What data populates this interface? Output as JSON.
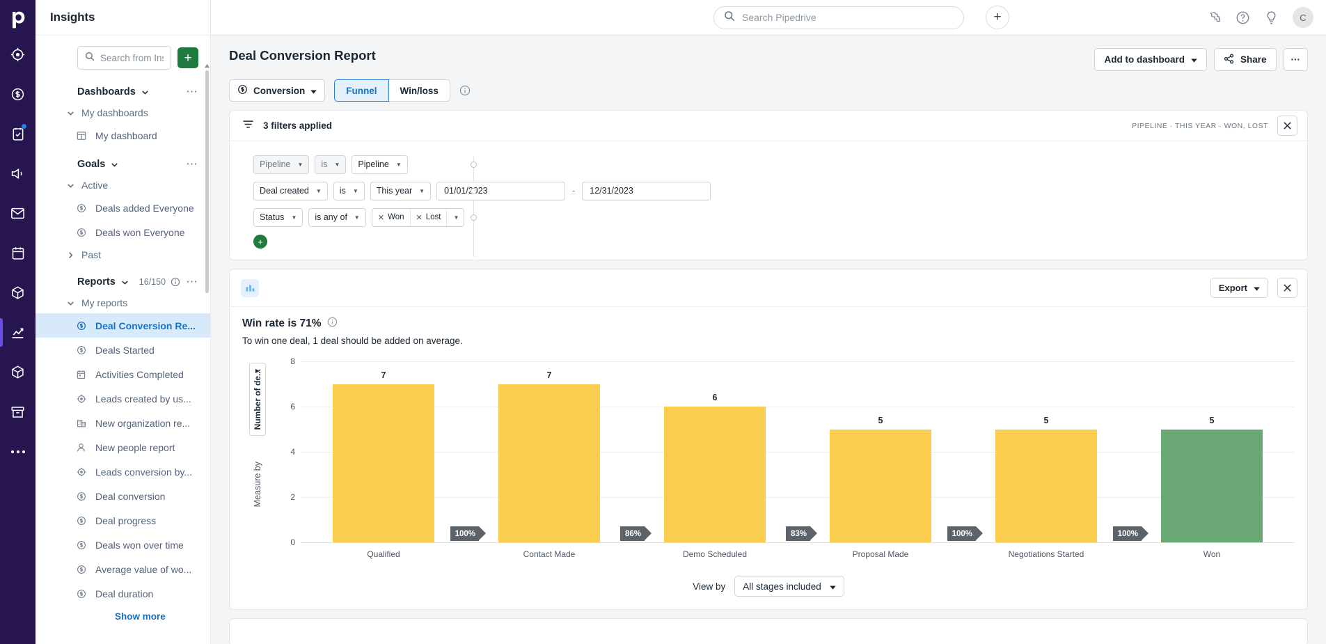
{
  "rail": {
    "logo": "pipedrive-logo",
    "items": [
      {
        "name": "leads-icon",
        "label": "Leads"
      },
      {
        "name": "deals-icon",
        "label": "Deals"
      },
      {
        "name": "activities-icon",
        "label": "Activities",
        "badge": true
      },
      {
        "name": "campaigns-icon",
        "label": "Campaigns"
      },
      {
        "name": "mail-icon",
        "label": "Mail"
      },
      {
        "name": "calendar-icon",
        "label": "Calendar"
      },
      {
        "name": "products-icon",
        "label": "Products"
      },
      {
        "name": "insights-icon",
        "label": "Insights",
        "active": true
      },
      {
        "name": "marketplace-icon",
        "label": "Marketplace"
      },
      {
        "name": "archive-icon",
        "label": "Archive"
      },
      {
        "name": "more-icon",
        "label": "..."
      }
    ]
  },
  "sidebar": {
    "title": "Insights",
    "search": {
      "value": "",
      "placeholder": "Search from Insi..."
    },
    "add_label": "+",
    "sections": [
      {
        "title": "Dashboards",
        "groups": [
          {
            "label": "My dashboards",
            "expanded": true,
            "items": [
              {
                "label": "My dashboard",
                "icon": "dashboard-icon"
              }
            ]
          }
        ]
      },
      {
        "title": "Goals",
        "groups": [
          {
            "label": "Active",
            "expanded": true,
            "items": [
              {
                "label": "Deals added Everyone",
                "icon": "deal-icon"
              },
              {
                "label": "Deals won Everyone",
                "icon": "deal-icon"
              }
            ]
          },
          {
            "label": "Past",
            "expanded": false,
            "items": []
          }
        ]
      },
      {
        "title": "Reports",
        "count": "16/150",
        "groups": [
          {
            "label": "My reports",
            "expanded": true,
            "items": [
              {
                "label": "Deal Conversion Re...",
                "icon": "deal-icon",
                "selected": true
              },
              {
                "label": "Deals Started",
                "icon": "deal-icon"
              },
              {
                "label": "Activities Completed",
                "icon": "calendar-icon"
              },
              {
                "label": "Leads created by us...",
                "icon": "leads-icon"
              },
              {
                "label": "New organization re...",
                "icon": "organization-icon"
              },
              {
                "label": "New people report",
                "icon": "person-icon"
              },
              {
                "label": "Leads conversion by...",
                "icon": "leads-icon"
              },
              {
                "label": "Deal conversion",
                "icon": "deal-icon"
              },
              {
                "label": "Deal progress",
                "icon": "deal-icon"
              },
              {
                "label": "Deals won over time",
                "icon": "deal-icon"
              },
              {
                "label": "Average value of wo...",
                "icon": "deal-icon"
              },
              {
                "label": "Deal duration",
                "icon": "deal-icon"
              }
            ]
          }
        ],
        "show_more": "Show more"
      }
    ]
  },
  "topbar": {
    "search": {
      "value": "",
      "placeholder": "Search Pipedrive"
    },
    "plus_label": "+",
    "icons": [
      "puzzle-icon",
      "help-icon",
      "lightbulb-icon"
    ],
    "avatar_initial": "C"
  },
  "report": {
    "title": "Deal Conversion Report",
    "type_selector": "Conversion",
    "tabs": [
      {
        "label": "Funnel",
        "active": true
      },
      {
        "label": "Win/loss",
        "active": false
      }
    ],
    "add_to_dashboard": "Add to dashboard",
    "share": "Share",
    "more": "···"
  },
  "filters": {
    "header": "3 filters applied",
    "meta": "PIPELINE · THIS YEAR · WON, LOST",
    "rows": [
      {
        "field": "Pipeline",
        "operator": "is",
        "value": "Pipeline",
        "dim": true
      },
      {
        "field": "Deal created",
        "operator": "is",
        "value": "This year",
        "date_from": "01/01/2023",
        "date_to": "12/31/2023",
        "dash": "-"
      },
      {
        "field": "Status",
        "operator": "is any of",
        "chips": [
          "Won",
          "Lost"
        ]
      }
    ],
    "add_label": "+"
  },
  "chart_panel": {
    "export": "Export",
    "win_rate_title": "Win rate is 71%",
    "win_rate_sub": "To win one deal, 1 deal should be added on average.",
    "measure_selector": "Number of de...",
    "measure_label": "Measure by",
    "view_by_label": "View by",
    "view_by_value": "All stages included"
  },
  "chart_data": {
    "type": "bar",
    "title": "Win rate is 71%",
    "xlabel": "",
    "ylabel": "Number of deals",
    "ylim": [
      0,
      8
    ],
    "yticks": [
      0,
      2,
      4,
      6,
      8
    ],
    "grid": true,
    "legend": "none",
    "categories": [
      "Qualified",
      "Contact Made",
      "Demo Scheduled",
      "Proposal Made",
      "Negotiations Started",
      "Won"
    ],
    "values": [
      7,
      7,
      6,
      5,
      5,
      5
    ],
    "bar_colors": [
      "#fbcd4e",
      "#fbcd4e",
      "#fbcd4e",
      "#fbcd4e",
      "#fbcd4e",
      "#6aa875"
    ],
    "conversion_labels": [
      "100%",
      "86%",
      "83%",
      "100%",
      "100%"
    ]
  },
  "colors": {
    "brand_purple": "#26154f",
    "accent_blue": "#1a72c4",
    "green": "#1f7a40",
    "bar_yellow": "#fbcd4e",
    "bar_green": "#6aa875",
    "pct_grey": "#5d636b"
  }
}
